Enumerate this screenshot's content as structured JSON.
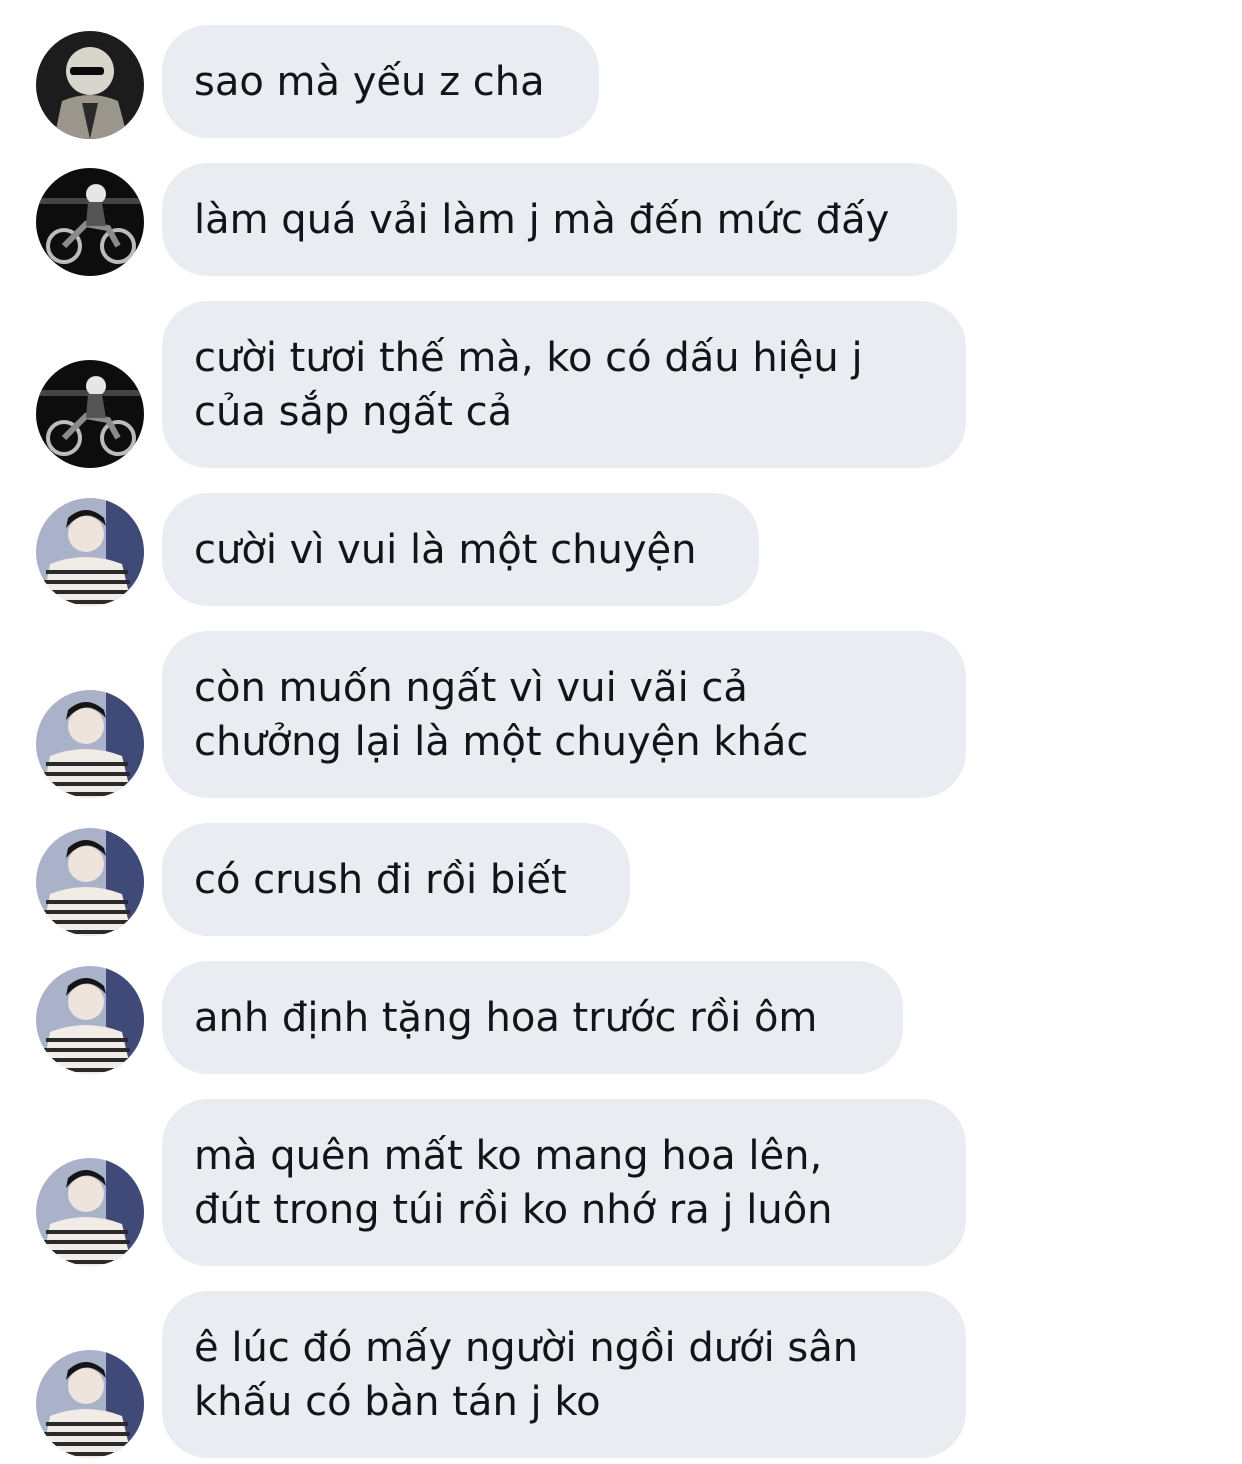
{
  "conversation": {
    "messages": [
      {
        "sender": "friend-a",
        "avatar_icon": "user-avatar-dark-sunglasses-icon",
        "lines": [
          "sao mà yếu z cha"
        ]
      },
      {
        "sender": "friend-b",
        "avatar_icon": "user-avatar-motorcycle-night-icon",
        "lines": [
          "làm quá vải làm j mà đến mức đấy"
        ]
      },
      {
        "sender": "friend-b",
        "avatar_icon": "user-avatar-motorcycle-night-icon",
        "lines": [
          "cười tươi thế mà, ko có dấu hiệu j",
          "của sắp ngất cả"
        ]
      },
      {
        "sender": "friend-c",
        "avatar_icon": "user-avatar-striped-sweater-icon",
        "lines": [
          "cười vì vui là một chuyện"
        ]
      },
      {
        "sender": "friend-c",
        "avatar_icon": "user-avatar-striped-sweater-icon",
        "lines": [
          "còn muốn ngất vì vui vãi cả",
          "chưởng lại là một chuyện khác"
        ]
      },
      {
        "sender": "friend-c",
        "avatar_icon": "user-avatar-striped-sweater-icon",
        "lines": [
          "có crush đi rồi biết"
        ]
      },
      {
        "sender": "friend-c",
        "avatar_icon": "user-avatar-striped-sweater-icon",
        "lines": [
          "anh định tặng hoa trước rồi ôm"
        ]
      },
      {
        "sender": "friend-c",
        "avatar_icon": "user-avatar-striped-sweater-icon",
        "lines": [
          "mà quên mất ko mang hoa lên,",
          "đút trong túi rồi ko nhớ ra j luôn"
        ]
      },
      {
        "sender": "friend-c",
        "avatar_icon": "user-avatar-striped-sweater-icon",
        "lines": [
          "ê lúc đó mấy người ngồi dưới sân",
          "khấu có bàn tán j ko"
        ]
      }
    ]
  },
  "colors": {
    "bubble_background": "#e9ecf0",
    "text": "#111418",
    "page_background": "#ffffff"
  }
}
